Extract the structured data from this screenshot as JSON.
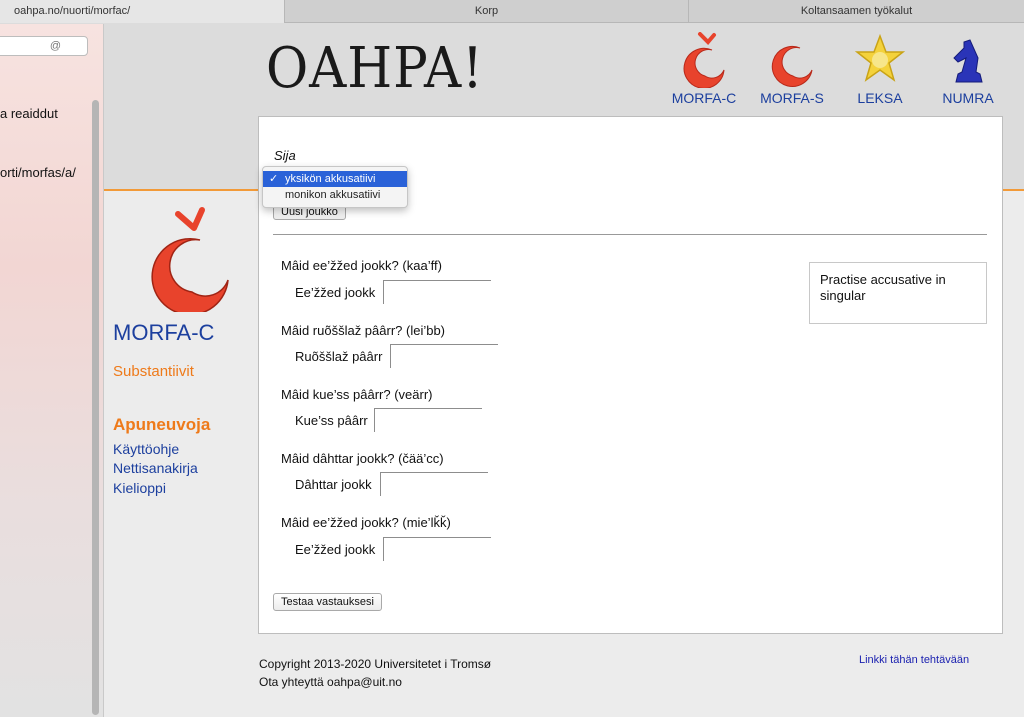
{
  "tabs": [
    {
      "label": "oahpa.no/nuorti/morfac/",
      "active": true
    },
    {
      "label": "Korp",
      "active": false
    },
    {
      "label": "Koltansaamen työkalut",
      "active": false
    }
  ],
  "left_panel": {
    "search_symbol": "@",
    "line1": "a reaiddut",
    "line2": "orti/morfas/a/"
  },
  "header": {
    "logo_text": "OAHPA!",
    "nav": [
      {
        "label": "MORFA-C",
        "icon": "morfa-c-icon"
      },
      {
        "label": "MORFA-S",
        "icon": "morfa-s-icon"
      },
      {
        "label": "LEKSA",
        "icon": "leksa-star-icon"
      },
      {
        "label": "NUMRA",
        "icon": "numra-knight-icon"
      }
    ]
  },
  "sidebar": {
    "section_title": "MORFA-C",
    "section_sub": "Substantiivit",
    "aids_title": "Apuneuvoja",
    "aids": [
      "Käyttöohje",
      "Nettisanakirja",
      "Kielioppi"
    ]
  },
  "exercise": {
    "case_label": "Sija",
    "case_options": [
      {
        "label": "yksikön akkusatiivi",
        "selected": true,
        "check": "✓"
      },
      {
        "label": "monikon akkusatiivi",
        "selected": false,
        "check": ""
      }
    ],
    "new_set_label": "Uusi joukko",
    "questions": [
      {
        "question": "Mâid ee’žžed jookk? (kaa’ff)",
        "prompt": "Ee’žžed jookk",
        "value": ""
      },
      {
        "question": "Mâid ruõššlaž pâârr? (lei’bb)",
        "prompt": "Ruõššlaž pâârr",
        "value": ""
      },
      {
        "question": "Mâid kue’ss pâârr? (veärr)",
        "prompt": "Kue’ss pâârr",
        "value": ""
      },
      {
        "question": "Mâid dâhttar jookk? (čää’cc)",
        "prompt": "Dâhttar jookk",
        "value": ""
      },
      {
        "question": "Mâid ee’žžed jookk? (mie’lǩǩ)",
        "prompt": "Ee’žžed jookk",
        "value": ""
      }
    ],
    "info_text": "Practise accusative in singular",
    "check_label": "Testaa vastauksesi"
  },
  "footer": {
    "copyright": "Copyright 2013-2020 Universitetet i Tromsø",
    "contact": "Ota yhteyttä oahpa@uit.no",
    "task_link": "Linkki tähän tehtävään"
  },
  "colors": {
    "brand_blue": "#1c3f9e",
    "accent_orange": "#ee7a1a",
    "selection_blue": "#2a62d8",
    "apple_red": "#e8432c"
  }
}
